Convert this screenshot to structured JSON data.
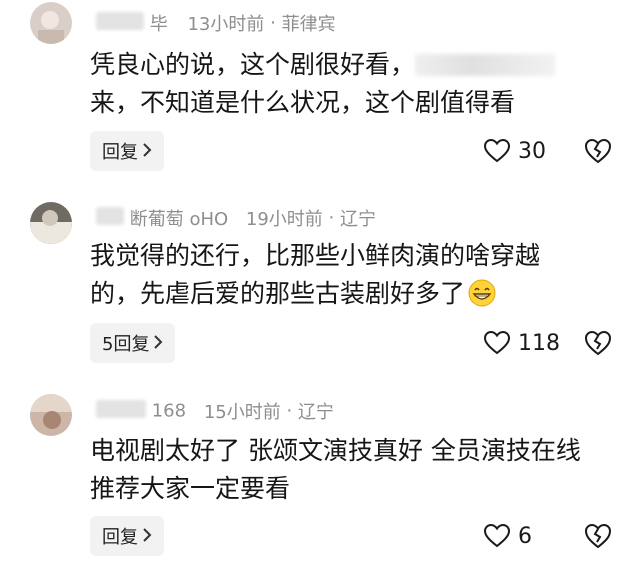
{
  "comments": [
    {
      "username": "毕",
      "time": "13小时前",
      "location": "菲律宾",
      "line1": "凭良心的说，这个剧很好看，",
      "line2": "来，不知道是什么状况，这个剧值得看",
      "reply_label": "回复",
      "likes": "30"
    },
    {
      "username": "断葡萄 oHO",
      "time": "19小时前",
      "location": "辽宁",
      "line1": "我觉得的还行，比那些小鲜肉演的啥穿越",
      "line2": "的，先虐后爱的那些古装剧好多了",
      "reply_label": "5回复",
      "likes": "118"
    },
    {
      "username": "168",
      "time": "15小时前",
      "location": "辽宁",
      "line1": "电视剧太好了 张颂文演技真好 全员演技在线",
      "line2": "推荐大家一定要看",
      "reply_label": "回复",
      "likes": "6"
    }
  ],
  "separator": "·",
  "icons": {
    "like": "heart-outline-icon",
    "dislike": "broken-heart-icon",
    "reply": "chevron-right-icon",
    "emoji": "grinning-emoji-icon"
  }
}
